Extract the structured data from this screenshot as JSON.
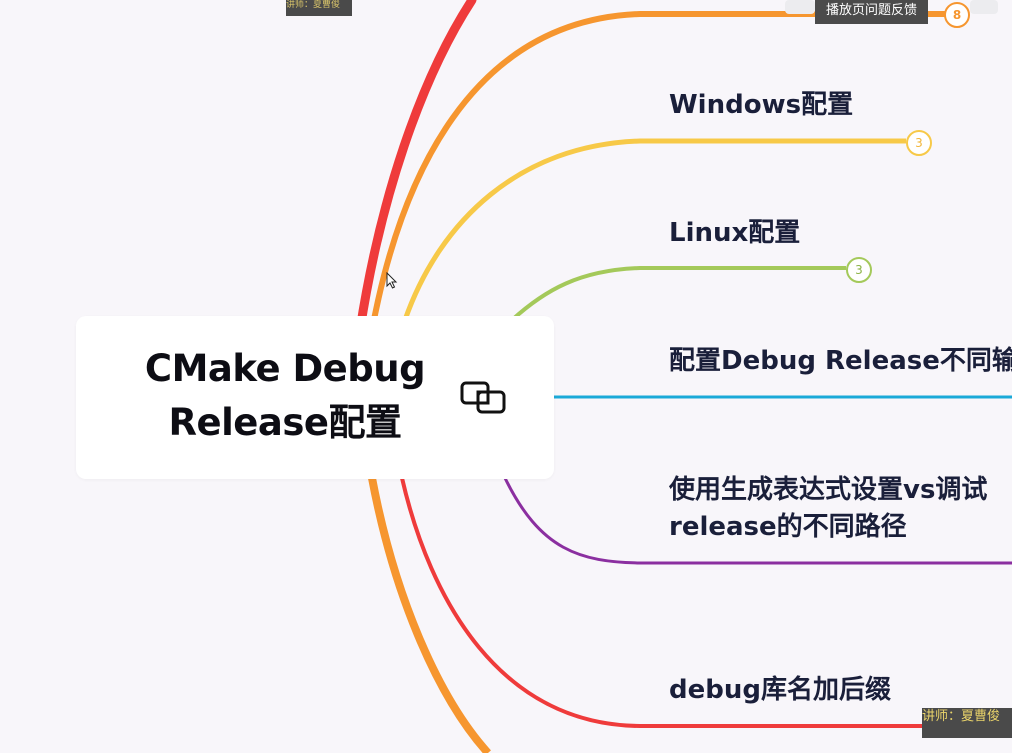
{
  "central_topic": {
    "line1": "CMake Debug",
    "line2": "Release配置",
    "link_icon": "linked-topics-icon"
  },
  "topics": [
    {
      "id": "windows",
      "label": "Windows配置",
      "count": "3",
      "color": "#f7c948"
    },
    {
      "id": "linux",
      "label": "Linux配置",
      "count": "3",
      "color": "#a4c95a"
    },
    {
      "id": "debug-release-output",
      "label": "配置Debug Release不同输",
      "color": "#1ba9d8"
    },
    {
      "id": "genexpr-line1",
      "label": "使用生成表达式设置vs调试"
    },
    {
      "id": "genexpr-line2",
      "label": "release的不同路径",
      "color": "#8b2fa0"
    },
    {
      "id": "debug-suffix",
      "label": "debug库名加后缀",
      "color": "#e83a3a"
    }
  ],
  "top_branch": {
    "count": "8",
    "color": "#f29132"
  },
  "overlay": {
    "feedback_button": "播放页问题反馈",
    "speaker_top": "讲师：夏曹俊",
    "speaker_bottom": "讲师：夏曹俊"
  },
  "colors": {
    "background": "#f8f6fa",
    "red": "#ef3b3b",
    "orange": "#f6962f",
    "yellow": "#f7c948",
    "green": "#a4c95a",
    "blue": "#1ba9d8",
    "purple": "#8b2fa0"
  }
}
